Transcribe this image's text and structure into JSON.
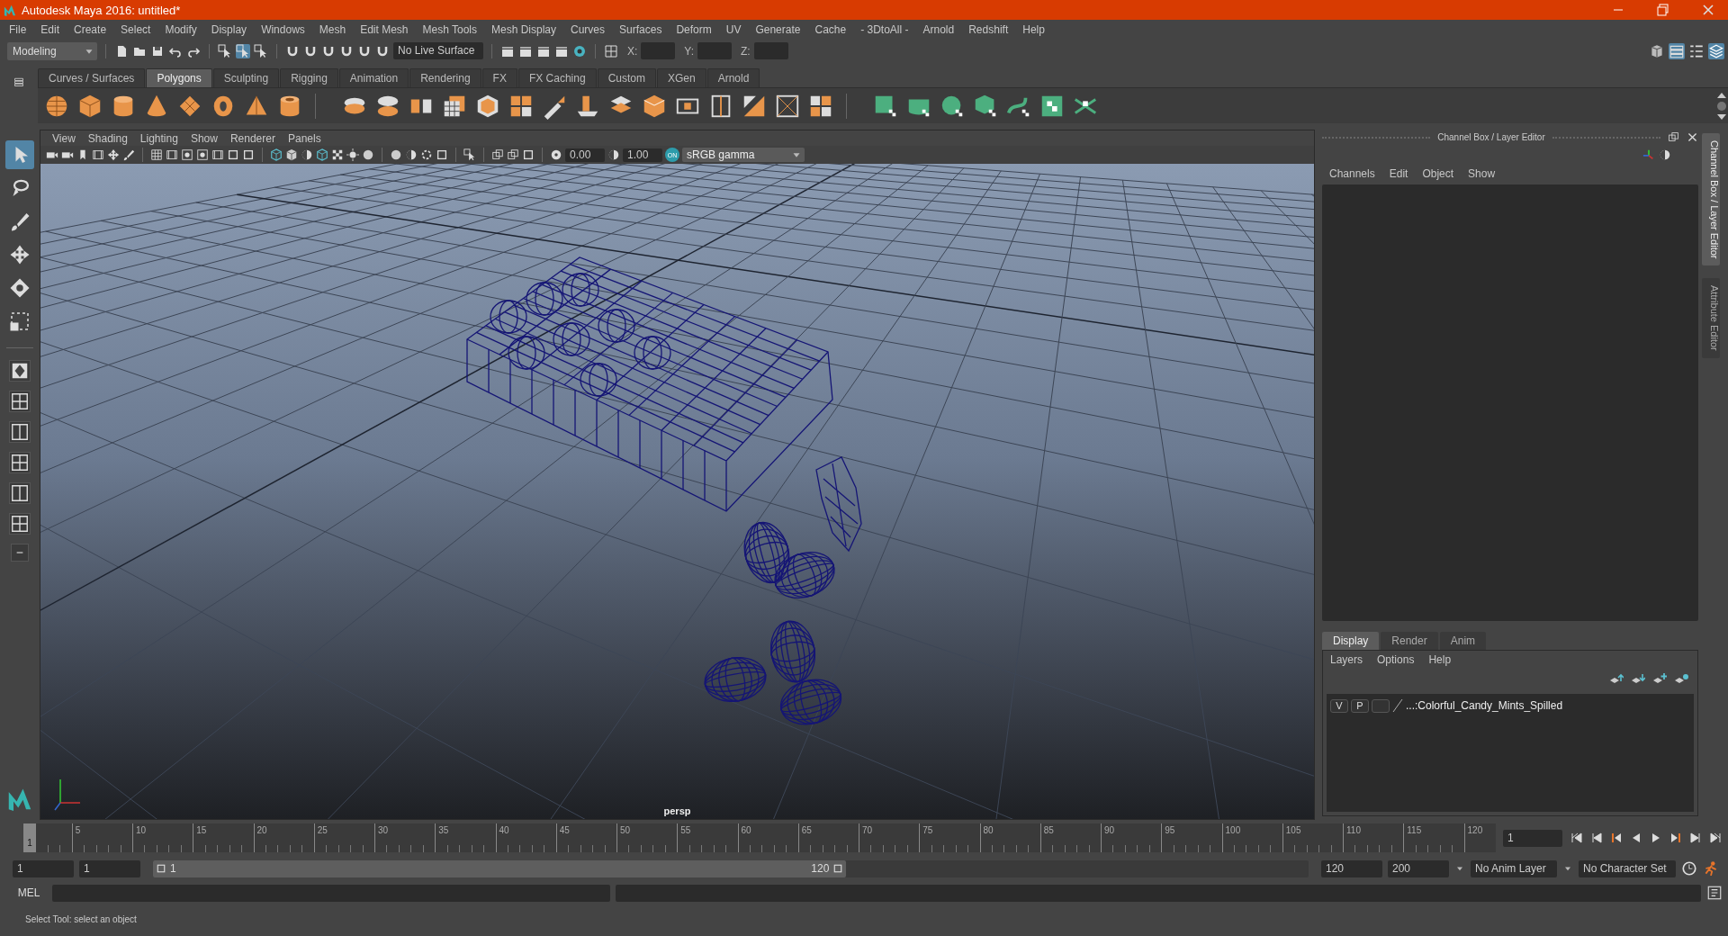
{
  "window": {
    "title": "Autodesk Maya 2016: untitled*"
  },
  "menu_bar": [
    "File",
    "Edit",
    "Create",
    "Select",
    "Modify",
    "Display",
    "Windows",
    "Mesh",
    "Edit Mesh",
    "Mesh Tools",
    "Mesh Display",
    "Curves",
    "Surfaces",
    "Deform",
    "UV",
    "Generate",
    "Cache",
    "- 3DtoAll -",
    "Arnold",
    "Redshift",
    "Help"
  ],
  "status_line": {
    "workspace": "Modeling",
    "live_surface": "No Live Surface",
    "coordinates": [
      {
        "label": "X:"
      },
      {
        "label": "Y:"
      },
      {
        "label": "Z:"
      }
    ]
  },
  "shelf": {
    "tabs": [
      {
        "label": "Curves / Surfaces",
        "selected": false
      },
      {
        "label": "Polygons",
        "selected": true
      },
      {
        "label": "Sculpting",
        "selected": false
      },
      {
        "label": "Rigging",
        "selected": false
      },
      {
        "label": "Animation",
        "selected": false
      },
      {
        "label": "Rendering",
        "selected": false
      },
      {
        "label": "FX",
        "selected": false
      },
      {
        "label": "FX Caching",
        "selected": false
      },
      {
        "label": "Custom",
        "selected": false
      },
      {
        "label": "XGen",
        "selected": false
      },
      {
        "label": "Arnold",
        "selected": false
      }
    ]
  },
  "toolbox": {
    "tools": [
      {
        "selected": true
      },
      {
        "selected": false
      },
      {
        "selected": false
      },
      {
        "selected": false
      },
      {
        "selected": false
      },
      {
        "selected": false
      }
    ]
  },
  "viewport": {
    "menus": [
      "View",
      "Shading",
      "Lighting",
      "Show",
      "Renderer",
      "Panels"
    ],
    "exposure": "0.00",
    "gamma": "1.00",
    "color_management": "ON",
    "view_transform": "sRGB gamma",
    "camera": "persp"
  },
  "channel_box": {
    "title": "Channel Box / Layer Editor",
    "menus": [
      "Channels",
      "Edit",
      "Object",
      "Show"
    ],
    "tabs": [
      {
        "label": "Display",
        "selected": true
      },
      {
        "label": "Render",
        "selected": false
      },
      {
        "label": "Anim",
        "selected": false
      }
    ],
    "layer_menus": [
      "Layers",
      "Options",
      "Help"
    ],
    "layers": [
      {
        "visible": "V",
        "playback": "P",
        "name": "...:Colorful_Candy_Mints_Spilled"
      }
    ]
  },
  "side_tabs": [
    {
      "label": "Channel Box / Layer Editor",
      "selected": true
    },
    {
      "label": "Attribute Editor",
      "selected": false
    }
  ],
  "timeline": {
    "current": "1",
    "level": 0,
    "ticks": [
      "5",
      "10",
      "15",
      "20",
      "25",
      "30",
      "35",
      "40",
      "45",
      "50",
      "55",
      "60",
      "65",
      "70",
      "75",
      "80",
      "85",
      "90",
      "95",
      "100",
      "105",
      "110",
      "115",
      "120"
    ],
    "current_frame": "1"
  },
  "range": {
    "start": "1",
    "playback_start": "1",
    "slider_start": "1",
    "slider_end": "120",
    "level": 0.6,
    "playback_end": "120",
    "end": "200",
    "anim_layer": "No Anim Layer",
    "character_set": "No Character Set"
  },
  "command_line": {
    "label": "MEL"
  },
  "help_line": "Select Tool: select an object"
}
